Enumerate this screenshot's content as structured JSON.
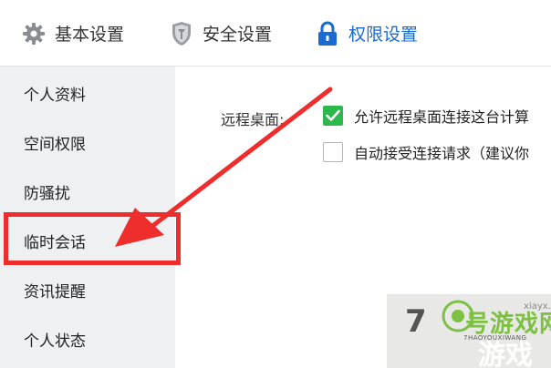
{
  "top_tabs": [
    {
      "label": "基本设置",
      "icon": "gear-icon",
      "active": false
    },
    {
      "label": "安全设置",
      "icon": "shield-icon",
      "active": false
    },
    {
      "label": "权限设置",
      "icon": "lock-icon",
      "active": true
    }
  ],
  "sidebar": {
    "items": [
      {
        "label": "个人资料"
      },
      {
        "label": "空间权限"
      },
      {
        "label": "防骚扰"
      },
      {
        "label": "临时会话",
        "highlighted": true
      },
      {
        "label": "资讯提醒"
      },
      {
        "label": "个人状态"
      }
    ]
  },
  "main": {
    "remote_desktop": {
      "label": "远程桌面:",
      "options": [
        {
          "label": "允许远程桌面连接这台计算",
          "checked": true
        },
        {
          "label": "自动接受连接请求（建议你",
          "checked": false
        }
      ]
    },
    "partial_text": "7"
  },
  "watermark": {
    "title": "号游戏网",
    "subtitle": "7HAOYOUXIWANG",
    "game": "游戏",
    "site": "xiayx.com"
  },
  "colors": {
    "accent": "#1a6bd0",
    "highlight_red": "#ee2d2d",
    "checkbox_green": "#2db84d",
    "sidebar_bg": "#eff0f2"
  }
}
